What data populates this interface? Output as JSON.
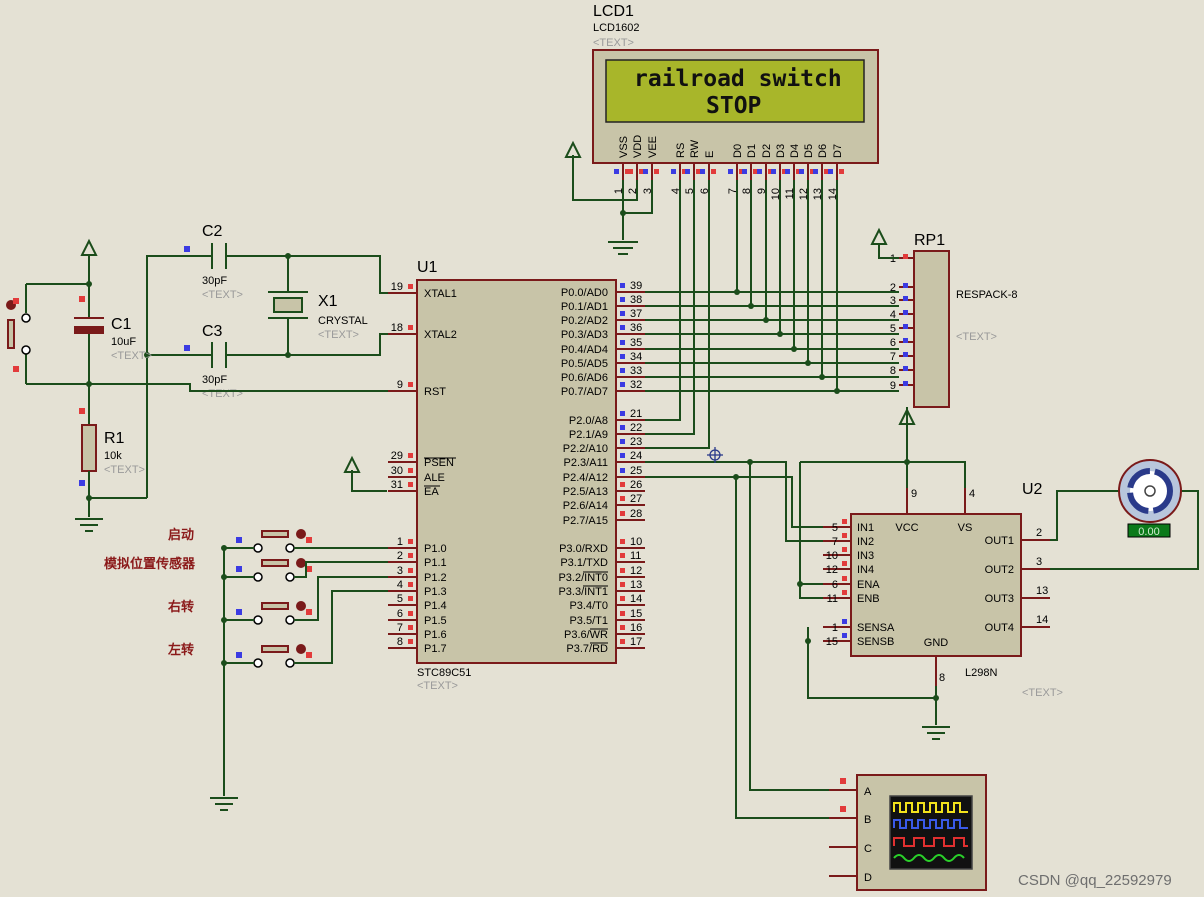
{
  "lcd": {
    "ref": "LCD1",
    "model": "LCD1602",
    "text_tag": "<TEXT>",
    "line1": "railroad switch",
    "line2": "STOP",
    "pins": [
      {
        "name": "VSS",
        "num": "1"
      },
      {
        "name": "VDD",
        "num": "2"
      },
      {
        "name": "VEE",
        "num": "3"
      },
      {
        "name": "RS",
        "num": "4"
      },
      {
        "name": "RW",
        "num": "5"
      },
      {
        "name": "E",
        "num": "6"
      },
      {
        "name": "D0",
        "num": "7"
      },
      {
        "name": "D1",
        "num": "8"
      },
      {
        "name": "D2",
        "num": "9"
      },
      {
        "name": "D3",
        "num": "10"
      },
      {
        "name": "D4",
        "num": "11"
      },
      {
        "name": "D5",
        "num": "12"
      },
      {
        "name": "D6",
        "num": "13"
      },
      {
        "name": "D7",
        "num": "14"
      }
    ],
    "colors": {
      "screen": "#a8b62a",
      "frame": "#7a1a1a"
    }
  },
  "c1": {
    "ref": "C1",
    "value": "10uF",
    "text_tag": "<TEXT>"
  },
  "c2": {
    "ref": "C2",
    "value": "30pF",
    "text_tag": "<TEXT>"
  },
  "c3": {
    "ref": "C3",
    "value": "30pF",
    "text_tag": "<TEXT>"
  },
  "x1": {
    "ref": "X1",
    "value": "CRYSTAL",
    "text_tag": "<TEXT>"
  },
  "r1": {
    "ref": "R1",
    "value": "10k",
    "text_tag": "<TEXT>"
  },
  "u1": {
    "ref": "U1",
    "model": "STC89C51",
    "text_tag": "<TEXT>",
    "left_pins": [
      {
        "name": "XTAL1",
        "num": "19"
      },
      {
        "name": "XTAL2",
        "num": "18"
      },
      {
        "name": "RST",
        "num": "9"
      },
      {
        "name": "PSEN",
        "num": "29"
      },
      {
        "name": "ALE",
        "num": "30"
      },
      {
        "name": "EA",
        "num": "31"
      },
      {
        "name": "P1.0",
        "num": "1"
      },
      {
        "name": "P1.1",
        "num": "2"
      },
      {
        "name": "P1.2",
        "num": "3"
      },
      {
        "name": "P1.3",
        "num": "4"
      },
      {
        "name": "P1.4",
        "num": "5"
      },
      {
        "name": "P1.5",
        "num": "6"
      },
      {
        "name": "P1.6",
        "num": "7"
      },
      {
        "name": "P1.7",
        "num": "8"
      }
    ],
    "right_pins": [
      {
        "name": "P0.0/AD0",
        "num": "39"
      },
      {
        "name": "P0.1/AD1",
        "num": "38"
      },
      {
        "name": "P0.2/AD2",
        "num": "37"
      },
      {
        "name": "P0.3/AD3",
        "num": "36"
      },
      {
        "name": "P0.4/AD4",
        "num": "35"
      },
      {
        "name": "P0.5/AD5",
        "num": "34"
      },
      {
        "name": "P0.6/AD6",
        "num": "33"
      },
      {
        "name": "P0.7/AD7",
        "num": "32"
      },
      {
        "name": "P2.0/A8",
        "num": "21"
      },
      {
        "name": "P2.1/A9",
        "num": "22"
      },
      {
        "name": "P2.2/A10",
        "num": "23"
      },
      {
        "name": "P2.3/A11",
        "num": "24"
      },
      {
        "name": "P2.4/A12",
        "num": "25"
      },
      {
        "name": "P2.5/A13",
        "num": "26"
      },
      {
        "name": "P2.6/A14",
        "num": "27"
      },
      {
        "name": "P2.7/A15",
        "num": "28"
      },
      {
        "name": "P3.0/RXD",
        "num": "10"
      },
      {
        "name": "P3.1/TXD",
        "num": "11"
      },
      {
        "name": "P3.2/INT0",
        "num": "12"
      },
      {
        "name": "P3.3/INT1",
        "num": "13"
      },
      {
        "name": "P3.4/T0",
        "num": "14"
      },
      {
        "name": "P3.5/T1",
        "num": "15"
      },
      {
        "name": "P3.6/WR",
        "num": "16"
      },
      {
        "name": "P3.7/RD",
        "num": "17"
      }
    ]
  },
  "rp1": {
    "ref": "RP1",
    "model": "RESPACK-8",
    "text_tag": "<TEXT>",
    "pins": [
      "1",
      "2",
      "3",
      "4",
      "5",
      "6",
      "7",
      "8",
      "9"
    ]
  },
  "u2": {
    "ref": "U2",
    "model": "L298N",
    "text_tag": "<TEXT>",
    "left_pins": [
      {
        "name": "IN1",
        "num": "5"
      },
      {
        "name": "IN2",
        "num": "7"
      },
      {
        "name": "IN3",
        "num": "10"
      },
      {
        "name": "IN4",
        "num": "12"
      },
      {
        "name": "ENA",
        "num": "6"
      },
      {
        "name": "ENB",
        "num": "11"
      },
      {
        "name": "SENSA",
        "num": "1"
      },
      {
        "name": "SENSB",
        "num": "15"
      }
    ],
    "right_pins": [
      {
        "name": "OUT1",
        "num": "2"
      },
      {
        "name": "OUT2",
        "num": "3"
      },
      {
        "name": "OUT3",
        "num": "13"
      },
      {
        "name": "OUT4",
        "num": "14"
      }
    ],
    "top_pins": [
      {
        "name": "VCC",
        "num": "9"
      },
      {
        "name": "VS",
        "num": "4"
      }
    ],
    "bottom_pins": [
      {
        "name": "GND",
        "num": "8"
      }
    ]
  },
  "motor": {
    "readout": "0.00"
  },
  "buttons": [
    {
      "label": "启动"
    },
    {
      "label": "模拟位置传感器"
    },
    {
      "label": "右转"
    },
    {
      "label": "左转"
    }
  ],
  "scope": {
    "channels": [
      "A",
      "B",
      "C",
      "D"
    ]
  },
  "watermark": "CSDN @qq_22592979",
  "icons": [
    "power-terminal-icon",
    "ground-icon",
    "dc-motor-icon",
    "oscilloscope-icon",
    "probe-marker-icon"
  ]
}
